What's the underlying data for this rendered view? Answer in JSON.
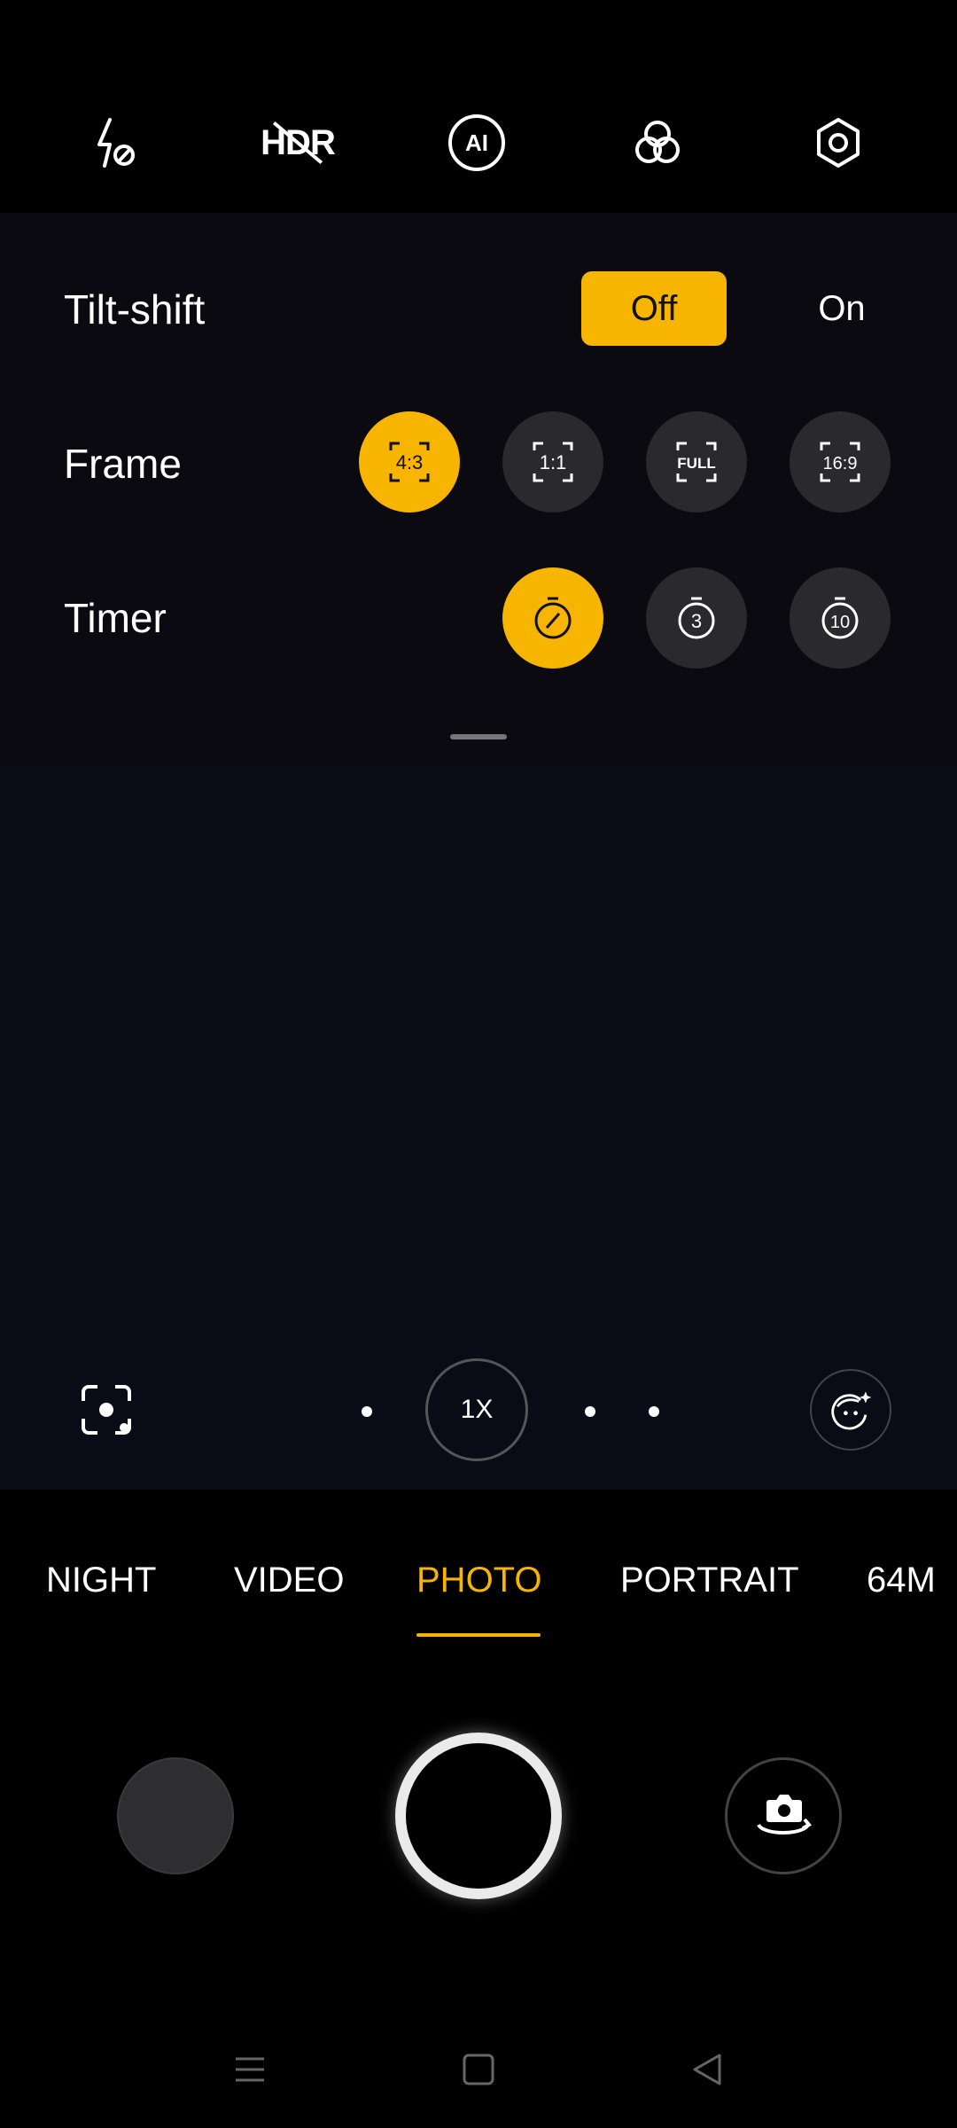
{
  "topbar": {
    "flash_icon": "flash-off-icon",
    "hdr_label": "HDR",
    "ai_label": "AI",
    "filters_icon": "filters-icon",
    "settings_icon": "settings-icon"
  },
  "settings": {
    "tilt_shift": {
      "label": "Tilt-shift",
      "off_label": "Off",
      "on_label": "On",
      "selected": "Off"
    },
    "frame": {
      "label": "Frame",
      "options": [
        "4:3",
        "1:1",
        "FULL",
        "16:9"
      ],
      "selected": "4:3"
    },
    "timer": {
      "label": "Timer",
      "options": [
        "off",
        "3",
        "10"
      ],
      "selected": "off"
    }
  },
  "viewfinder": {
    "zoom_label": "1X"
  },
  "modes": [
    "NIGHT",
    "VIDEO",
    "PHOTO",
    "PORTRAIT",
    "64M"
  ],
  "active_mode": "PHOTO",
  "colors": {
    "accent": "#f7b500",
    "panel": "#0a0a10",
    "viewfinder": "#0b0a17"
  }
}
